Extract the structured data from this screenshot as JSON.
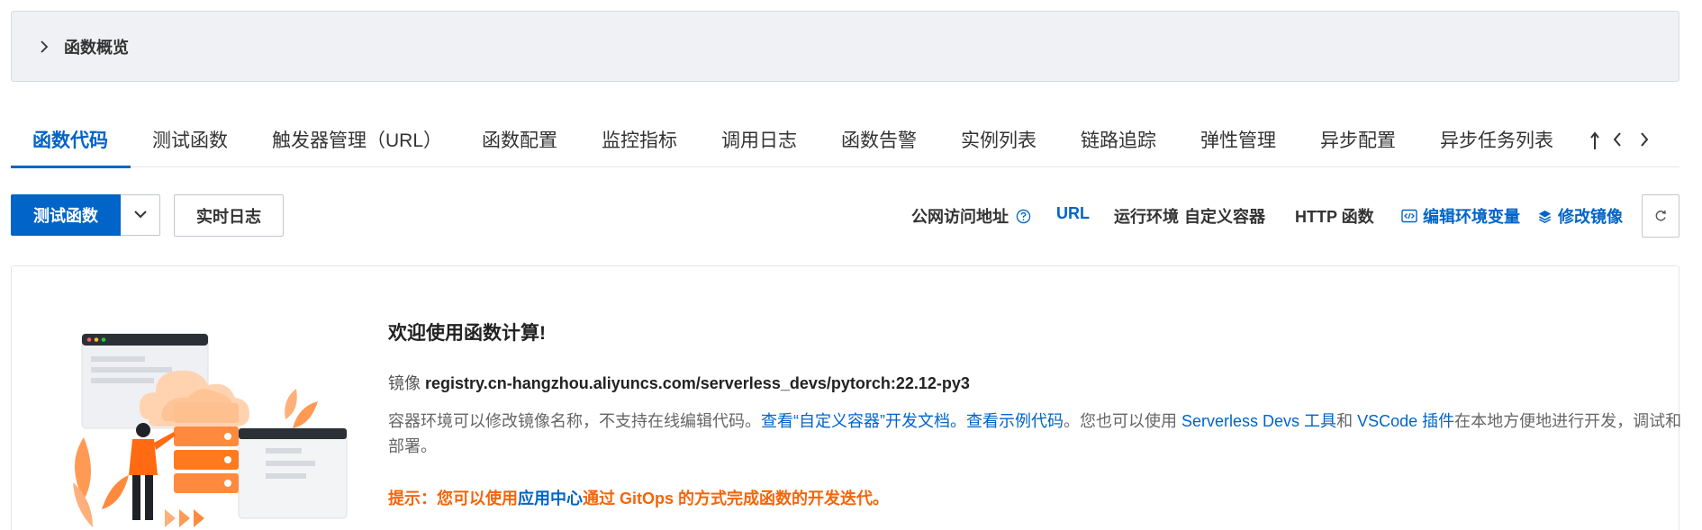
{
  "overview": {
    "title": "函数概览"
  },
  "tabs": [
    {
      "label": "函数代码",
      "active": true
    },
    {
      "label": "测试函数"
    },
    {
      "label": "触发器管理（URL）"
    },
    {
      "label": "函数配置"
    },
    {
      "label": "监控指标"
    },
    {
      "label": "调用日志"
    },
    {
      "label": "函数告警"
    },
    {
      "label": "实例列表"
    },
    {
      "label": "链路追踪"
    },
    {
      "label": "弹性管理"
    },
    {
      "label": "异步配置"
    },
    {
      "label": "异步任务列表"
    }
  ],
  "toolbar": {
    "test_button": "测试函数",
    "realtime_log_button": "实时日志",
    "public_access_label": "公网访问地址",
    "url_link": "URL",
    "runtime_label": "运行环境",
    "runtime_value": "自定义容器",
    "function_type": "HTTP 函数",
    "edit_env_link": "编辑环境变量",
    "edit_image_link": "修改镜像"
  },
  "welcome": {
    "title": "欢迎使用函数计算!",
    "image_label": "镜像",
    "image_value": "registry.cn-hangzhou.aliyuncs.com/serverless_devs/pytorch:22.12-py3",
    "desc_1": "容器环境可以修改镜像名称，不支持在线编辑代码。",
    "desc_link_1": "查看“自定义容器”开发文档。",
    "desc_link_2": "查看示例代码",
    "desc_2": "。您也可以使用 ",
    "desc_link_3": "Serverless Devs 工具",
    "desc_3": "和 ",
    "desc_link_4": "VSCode 插件",
    "desc_4": "在本地方便地进行开发，调试和部署。",
    "hint_prefix": "提示：您可以使用",
    "hint_link": "应用中心",
    "hint_suffix": "通过 GitOps 的方式完成函数的开发迭代。"
  },
  "colors": {
    "primary": "#0064c8",
    "warning": "#f5650a",
    "illustration_orange": "#ff8a3d"
  },
  "icons": [
    "chevron-right-icon",
    "chevron-down-icon",
    "question-circle-icon",
    "code-icon",
    "layers-icon",
    "refresh-icon",
    "tab-prev-icon",
    "tab-next-icon"
  ]
}
